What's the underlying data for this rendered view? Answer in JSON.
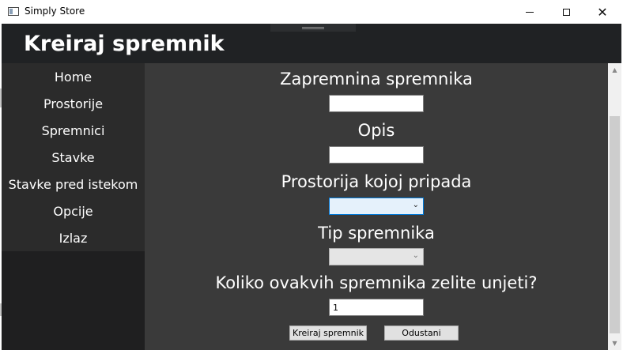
{
  "window": {
    "title": "Simply Store",
    "minimize_glyph": "",
    "maximize_glyph": "",
    "close_glyph": "✕"
  },
  "header": {
    "title": "Kreiraj spremnik"
  },
  "sidebar": {
    "items": [
      {
        "label": "Home"
      },
      {
        "label": "Prostorije"
      },
      {
        "label": "Spremnici"
      },
      {
        "label": "Stavke"
      },
      {
        "label": "Stavke pred istekom"
      },
      {
        "label": "Opcije"
      },
      {
        "label": "Izlaz"
      }
    ]
  },
  "form": {
    "volume_label": "Zapremnina spremnika",
    "volume_value": "",
    "description_label": "Opis",
    "description_value": "",
    "room_label": "Prostorija kojoj pripada",
    "room_selected": "",
    "type_label": "Tip spremnika",
    "type_selected": "",
    "quantity_label": "Koliko ovakvih spremnika zelite unjeti?",
    "quantity_value": "1",
    "create_button": "Kreiraj spremnik",
    "cancel_button": "Odustani"
  },
  "colors": {
    "header_bg": "#202224",
    "sidebar_bg": "#2b2b2b",
    "main_bg": "#3a3a3a",
    "text": "#ffffff"
  },
  "icons": {
    "chevron": "⌄",
    "scroll_up": "▲",
    "scroll_down": "▼"
  }
}
